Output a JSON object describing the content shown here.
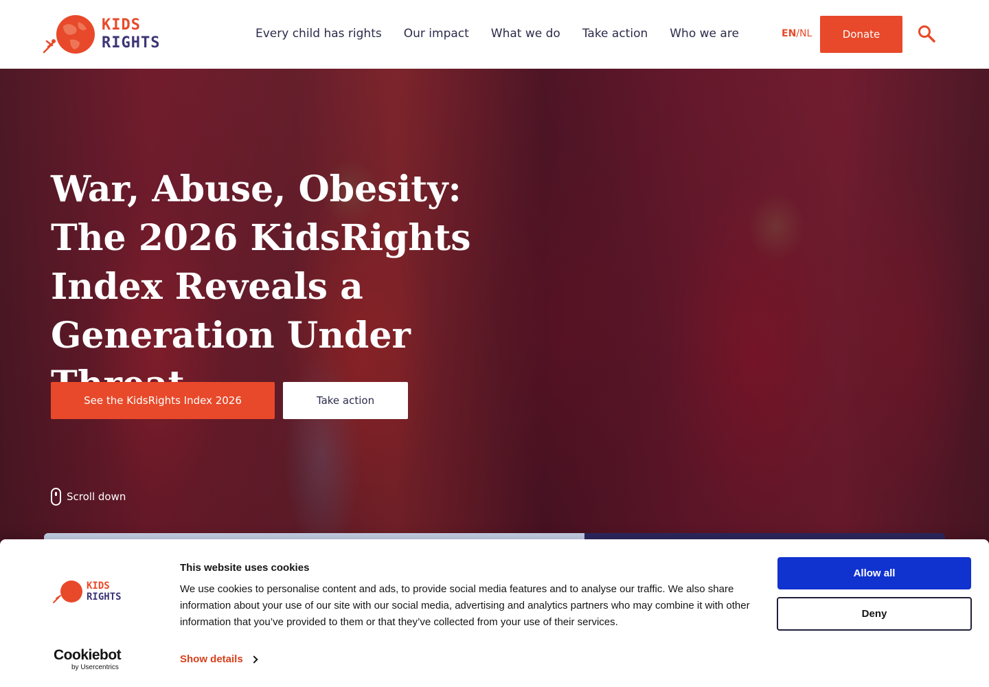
{
  "header": {
    "logo": {
      "line1": "KIDS",
      "line2": "RIGHTS"
    },
    "nav": [
      {
        "label": "Every child has rights"
      },
      {
        "label": "Our impact"
      },
      {
        "label": "What we do"
      },
      {
        "label": "Take action"
      },
      {
        "label": "Who we are"
      }
    ],
    "lang": {
      "current": "EN",
      "separator": "/",
      "other": "NL"
    },
    "donate_label": "Donate",
    "search_icon": "search-icon"
  },
  "hero": {
    "title_bold": "War, Abuse, Obesity:",
    "title_rest": " The 2026 KidsRights Index Reveals a Generation Under Threat.",
    "primary_button": "See the KidsRights Index 2026",
    "secondary_button": "Take action",
    "scroll_label": "Scroll down"
  },
  "cookie": {
    "logo": {
      "line1": "KIDS",
      "line2": "RIGHTS"
    },
    "title": "This website uses cookies",
    "text": "We use cookies to personalise content and ads, to provide social media features and to analyse our traffic. We also share information about your use of our site with our social media, advertising and analytics partners who may combine it with other information that you’ve provided to them or that they’ve collected from your use of their services.",
    "show_details": "Show details",
    "allow_all": "Allow all",
    "deny": "Deny",
    "brand": "Cookiebot",
    "brand_sub": "by Usercentrics"
  },
  "colors": {
    "brand_orange": "#e8492a",
    "brand_purple": "#3d3575",
    "allow_blue": "#1032cf"
  }
}
